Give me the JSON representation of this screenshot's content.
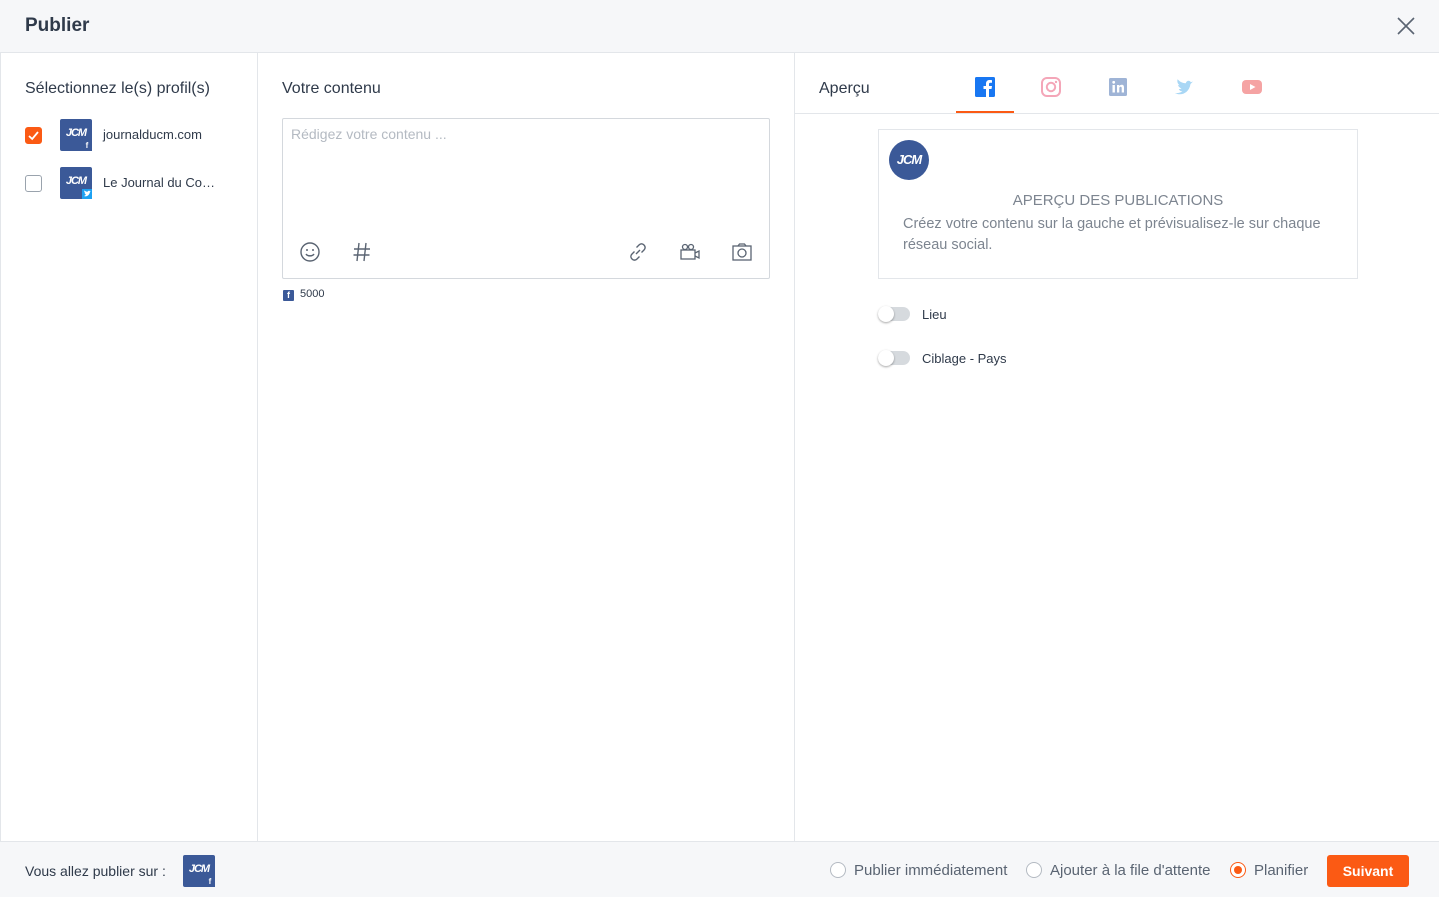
{
  "header": {
    "title": "Publier"
  },
  "profiles": {
    "title": "Sélectionnez le(s) profil(s)",
    "items": [
      {
        "name": "journalducm.com",
        "checked": true,
        "network": "facebook",
        "logo": "JCM"
      },
      {
        "name": "Le Journal du Co…",
        "checked": false,
        "network": "twitter",
        "logo": "JCM"
      }
    ]
  },
  "content": {
    "title": "Votre contenu",
    "placeholder": "Rédigez votre contenu ...",
    "char_count": "5000",
    "tools": [
      "emoji-icon",
      "hashtag-icon",
      "link-icon",
      "video-camera-icon",
      "photo-camera-icon"
    ]
  },
  "preview": {
    "title": "Aperçu",
    "tabs": [
      "facebook-icon",
      "instagram-icon",
      "linkedin-icon",
      "twitter-icon",
      "youtube-icon"
    ],
    "active_tab": "facebook-icon",
    "avatar_logo": "JCM",
    "card_title": "APERÇU DES PUBLICATIONS",
    "card_text": "Créez votre contenu sur la gauche et prévisualisez-le sur chaque réseau social.",
    "toggles": [
      {
        "label": "Lieu",
        "on": false
      },
      {
        "label": "Ciblage - Pays",
        "on": false
      }
    ]
  },
  "footer": {
    "label": "Vous allez publier sur :",
    "avatar_logo": "JCM",
    "options": [
      "Publier immédiatement",
      "Ajouter à la file d'attente",
      "Planifier"
    ],
    "selected_option": "Planifier",
    "next_label": "Suivant"
  },
  "colors": {
    "accent": "#fb5a14",
    "facebook": "#3b5998",
    "instagram": "#f4a6b8",
    "linkedin": "#9fb4d6",
    "twitter": "#a9d7f5",
    "youtube": "#f5a3a3"
  }
}
